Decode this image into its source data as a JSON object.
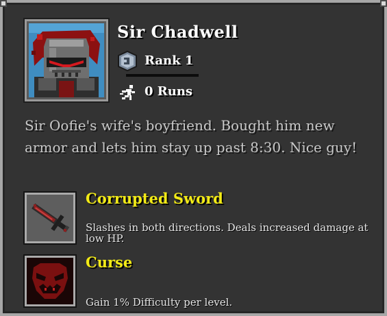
{
  "character": {
    "name": "Sir Chadwell",
    "rank_label": "Rank 1",
    "runs_label": "0 Runs",
    "description": "Sir Oofie's wife's boyfriend. Bought him new armor and lets him stay up past 8:30. Nice guy!"
  },
  "abilities": [
    {
      "title": "Corrupted Sword",
      "description": "Slashes in both directions. Deals increased damage at low HP.",
      "icon": "corrupted-sword-icon"
    },
    {
      "title": "Curse",
      "description": "Gain 1% Difficulty per level.",
      "icon": "curse-face-icon"
    }
  ],
  "colors": {
    "panel_bg": "#333333",
    "border": "#a7a7a7",
    "ability_title": "#f2ea16",
    "text": "#ffffff",
    "description_text": "#c9c9c9"
  }
}
